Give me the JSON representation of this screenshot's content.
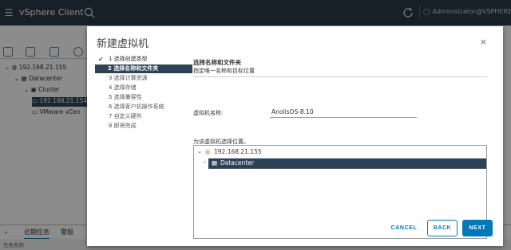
{
  "header": {
    "app_title": "vSphere Client",
    "user": "Administrator@VSPHERE.LOC"
  },
  "inventory": {
    "tree": [
      {
        "label": "192.168.21.155"
      },
      {
        "label": "Datacenter"
      },
      {
        "label": "Cluster"
      },
      {
        "label": "192.168.21.154"
      },
      {
        "label": "VMware vCen"
      }
    ]
  },
  "bottom_panel": {
    "tabs": [
      "近期任务",
      "警报"
    ],
    "column": "任务名称"
  },
  "modal": {
    "title": "新建虚拟机",
    "close": "×",
    "steps": [
      {
        "label": "1 选择创建类型",
        "state": "done"
      },
      {
        "label": "2 选择名称和文件夹",
        "state": "current"
      },
      {
        "label": "3 选择计算资源",
        "state": "pending"
      },
      {
        "label": "4 选择存储",
        "state": "pending"
      },
      {
        "label": "5 选择兼容性",
        "state": "pending"
      },
      {
        "label": "6 选择客户机操作系统",
        "state": "pending"
      },
      {
        "label": "7 自定义硬件",
        "state": "pending"
      },
      {
        "label": "8 即将完成",
        "state": "pending"
      }
    ],
    "section_title": "选择名称和文件夹",
    "section_subtitle": "指定唯一名称和目标位置",
    "vm_name_label": "虚拟机名称:",
    "vm_name_value": "AnolisOS-8.10",
    "location_label": "为该虚拟机选择位置。",
    "location_tree": [
      {
        "label": "192.168.21.155",
        "expanded": true
      },
      {
        "label": "Datacenter",
        "selected": true
      }
    ],
    "buttons": {
      "cancel": "CANCEL",
      "back": "BACK",
      "next": "NEXT"
    }
  },
  "colors": {
    "header_bg": "#2b3a4a",
    "selected_bg": "#2e4257",
    "primary": "#0079b8",
    "check": "#2f8400"
  }
}
